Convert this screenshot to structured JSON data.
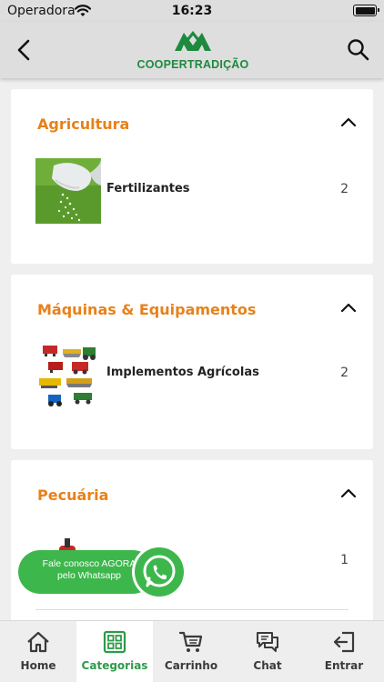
{
  "status_bar": {
    "carrier": "Operadora",
    "time": "16:23"
  },
  "header": {
    "logo_text": "COOPERTRADIÇÃO",
    "back_icon": "chevron-left-icon",
    "search_icon": "search-icon"
  },
  "categories": [
    {
      "title": "Agricultura",
      "expanded": true,
      "items": [
        {
          "label": "Fertilizantes",
          "count": "2",
          "image": "fertilizer-photo"
        }
      ]
    },
    {
      "title": "Máquinas & Equipamentos",
      "expanded": true,
      "items": [
        {
          "label": "Implementos Agrícolas",
          "count": "2",
          "image": "machinery-photo"
        }
      ]
    },
    {
      "title": "Pecuária",
      "expanded": true,
      "items": [
        {
          "label": "",
          "count": "1",
          "image": "livestock-product-photo"
        }
      ]
    }
  ],
  "whatsapp_button": {
    "text_line1": "Fale conosco AGORA",
    "text_line2": "pelo Whatsapp",
    "icon": "whatsapp-icon"
  },
  "tab_bar": {
    "active": "Categorias",
    "tabs": [
      {
        "label": "Home",
        "icon": "home-icon"
      },
      {
        "label": "Categorias",
        "icon": "grid-icon"
      },
      {
        "label": "Carrinho",
        "icon": "cart-icon"
      },
      {
        "label": "Chat",
        "icon": "chat-icon"
      },
      {
        "label": "Entrar",
        "icon": "login-icon"
      }
    ]
  },
  "colors": {
    "brand_green": "#1d8a3e",
    "category_orange": "#e8811a",
    "active_tab_green": "#2e9a4a",
    "whatsapp_green": "#3db74c"
  }
}
